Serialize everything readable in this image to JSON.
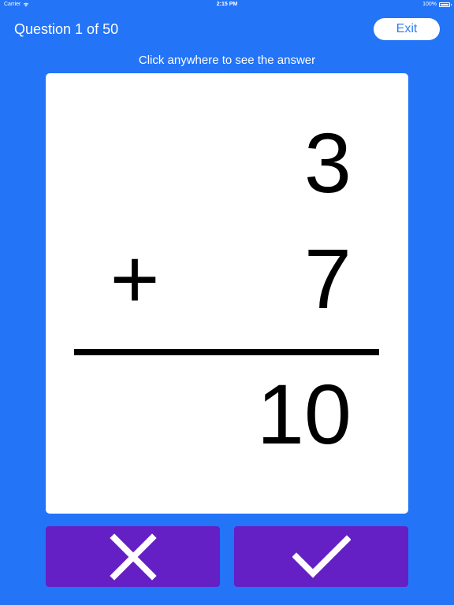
{
  "status_bar": {
    "carrier": "Carrier",
    "time": "2:15 PM",
    "battery": "100%"
  },
  "header": {
    "question_counter": "Question 1 of 50",
    "exit_label": "Exit"
  },
  "hint": "Click anywhere to see the answer",
  "problem": {
    "top_operand": "3",
    "operator": "+",
    "bottom_operand": "7",
    "answer": "10"
  },
  "buttons": {
    "wrong_icon": "close-x-icon",
    "right_icon": "checkmark-icon"
  },
  "colors": {
    "background": "#2374f7",
    "card": "#ffffff",
    "button": "#6420c4",
    "exit_text": "#2f7cf6"
  }
}
